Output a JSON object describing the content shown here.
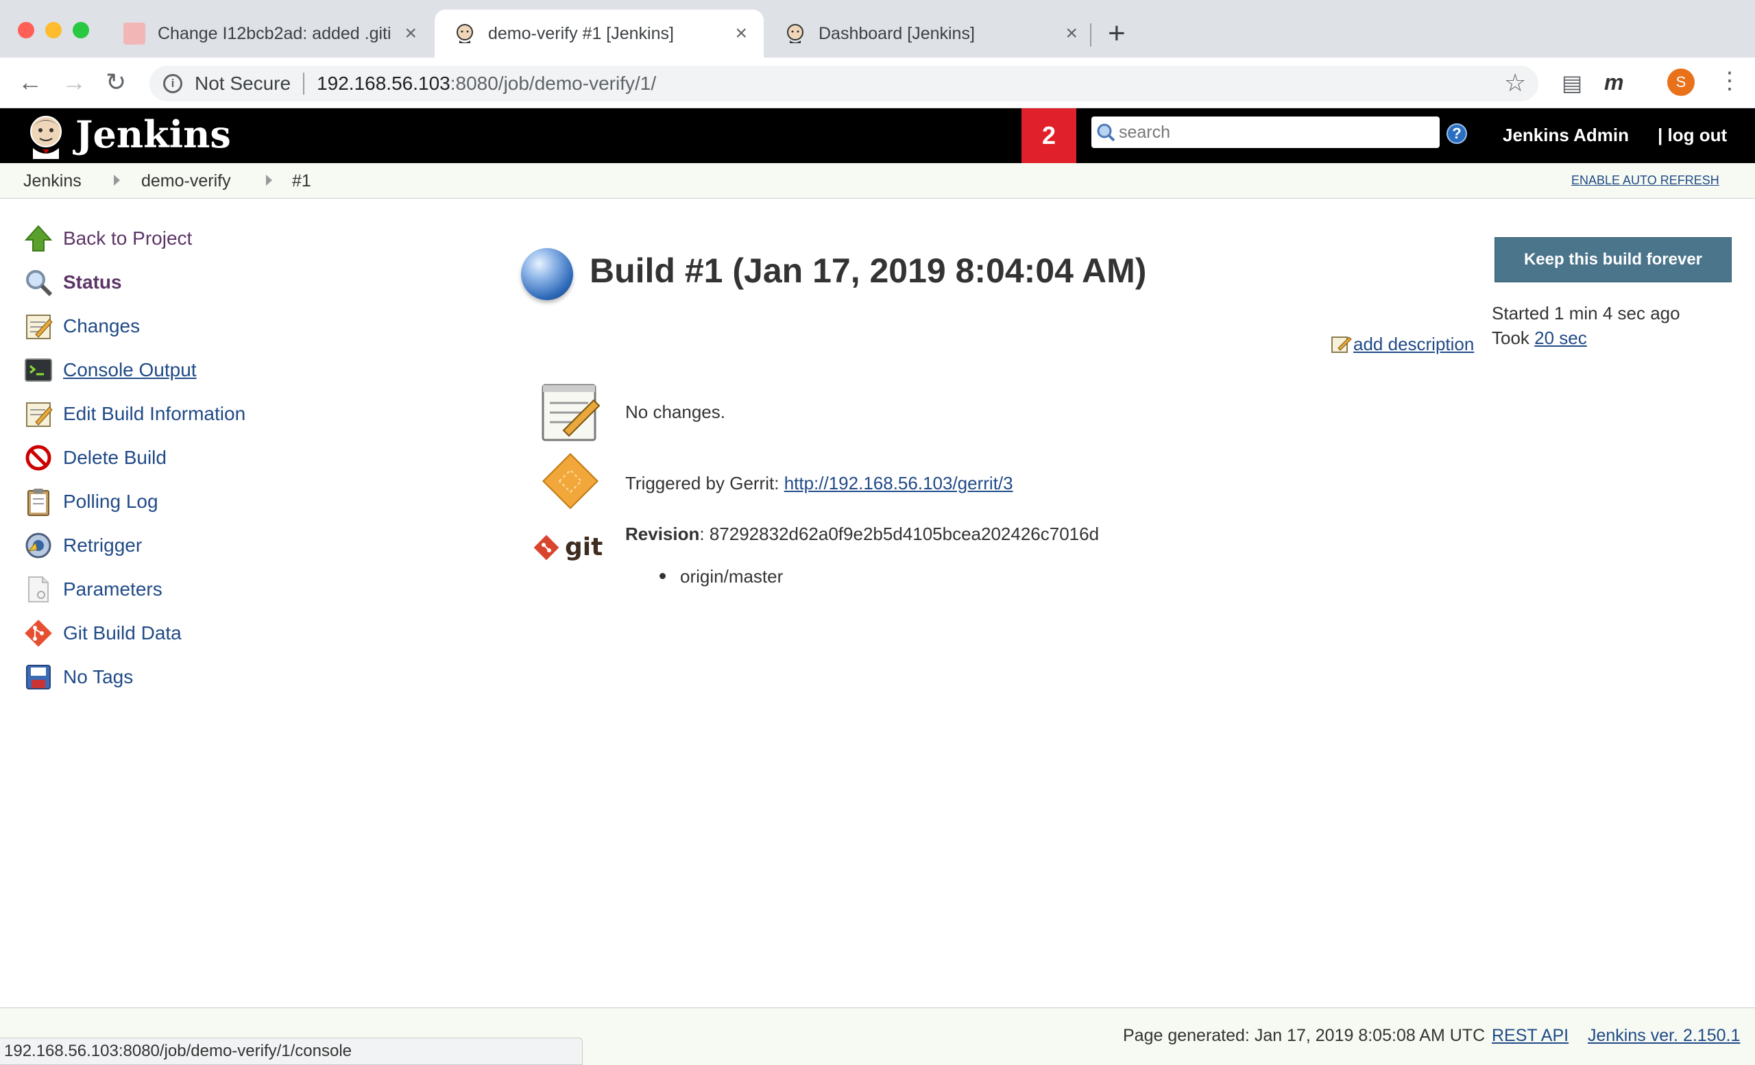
{
  "browser": {
    "tabs": [
      {
        "title": "Change I12bcb2ad: added .giti",
        "active": false,
        "icon": "gerrit-favicon"
      },
      {
        "title": "demo-verify #1 [Jenkins]",
        "active": true,
        "icon": "jenkins-favicon"
      },
      {
        "title": "Dashboard [Jenkins]",
        "active": false,
        "icon": "jenkins-favicon"
      }
    ],
    "security_label": "Not Secure",
    "url_host": "192.168.56.103",
    "url_path": ":8080/job/demo-verify/1/",
    "profile_initial": "S",
    "profile_color": "#e8711a",
    "status_url": "192.168.56.103:8080/job/demo-verify/1/console"
  },
  "header": {
    "title": "Jenkins",
    "notification_count": "2",
    "search_placeholder": "search",
    "help": "?",
    "user": "Jenkins Admin",
    "logout": "log out"
  },
  "breadcrumb": {
    "items": [
      "Jenkins",
      "demo-verify",
      "#1"
    ],
    "auto_refresh": "ENABLE AUTO REFRESH"
  },
  "sidebar": {
    "items": [
      {
        "label": "Back to Project",
        "icon": "up-arrow-icon"
      },
      {
        "label": "Status",
        "icon": "magnifier-icon"
      },
      {
        "label": "Changes",
        "icon": "notepad-icon"
      },
      {
        "label": "Console Output",
        "icon": "terminal-icon"
      },
      {
        "label": "Edit Build Information",
        "icon": "notepad-icon"
      },
      {
        "label": "Delete Build",
        "icon": "no-entry-icon"
      },
      {
        "label": "Polling Log",
        "icon": "clipboard-icon"
      },
      {
        "label": "Retrigger",
        "icon": "retrigger-icon"
      },
      {
        "label": "Parameters",
        "icon": "document-icon"
      },
      {
        "label": "Git Build Data",
        "icon": "git-icon"
      },
      {
        "label": "No Tags",
        "icon": "save-icon"
      }
    ]
  },
  "build": {
    "title": "Build #1 (Jan 17, 2019 8:04:04 AM)",
    "status_color": "#2d68b8",
    "keep_button": "Keep this build forever",
    "started": "Started 1 min 4 sec ago",
    "took_prefix": "Took",
    "took_value": "20 sec",
    "add_description": "add description",
    "changes": "No changes.",
    "triggered_prefix": "Triggered by Gerrit:",
    "triggered_link": "http://192.168.56.103/gerrit/3",
    "revision_label": "Revision",
    "revision_value": ": 87292832d62a0f9e2b5d4105bcea202426c7016d",
    "branches": [
      "origin/master"
    ]
  },
  "footer": {
    "page_generated": "Page generated: Jan 17, 2019 8:05:08 AM UTC",
    "rest_api": "REST API",
    "version": "Jenkins ver. 2.150.1"
  }
}
